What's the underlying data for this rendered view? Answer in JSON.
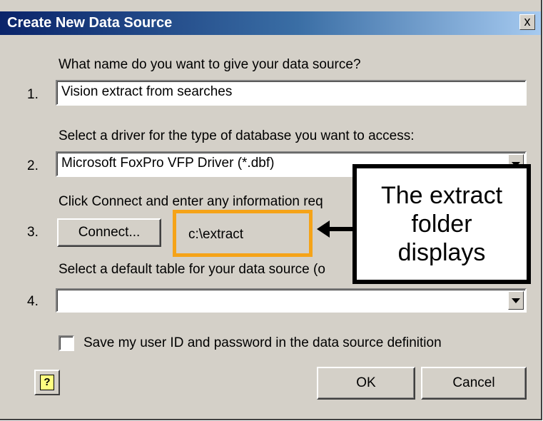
{
  "dialog": {
    "title": "Create New Data Source",
    "close_glyph": "x"
  },
  "step1": {
    "number": "1.",
    "prompt": "What name do you want to give your data source?",
    "value": "Vision extract from searches"
  },
  "step2": {
    "number": "2.",
    "prompt": "Select a driver for the type of database you want to access:",
    "value": "Microsoft FoxPro VFP Driver (*.dbf)"
  },
  "step3": {
    "number": "3.",
    "prompt": "Click Connect and enter any information req",
    "button_label": "Connect...",
    "path": "c:\\extract"
  },
  "step4": {
    "number": "4.",
    "prompt": "Select a default table for your data source (o",
    "value": ""
  },
  "checkbox": {
    "label": "Save my user ID and password in the data source definition",
    "checked": false
  },
  "footer": {
    "help_glyph": "?",
    "ok_label": "OK",
    "cancel_label": "Cancel"
  },
  "callout": {
    "line1": "The extract",
    "line2": "folder",
    "line3": "displays"
  },
  "colors": {
    "highlight": "#f5a318",
    "titlebar": "#0a246a",
    "dialog_bg": "#d4d0c8"
  }
}
